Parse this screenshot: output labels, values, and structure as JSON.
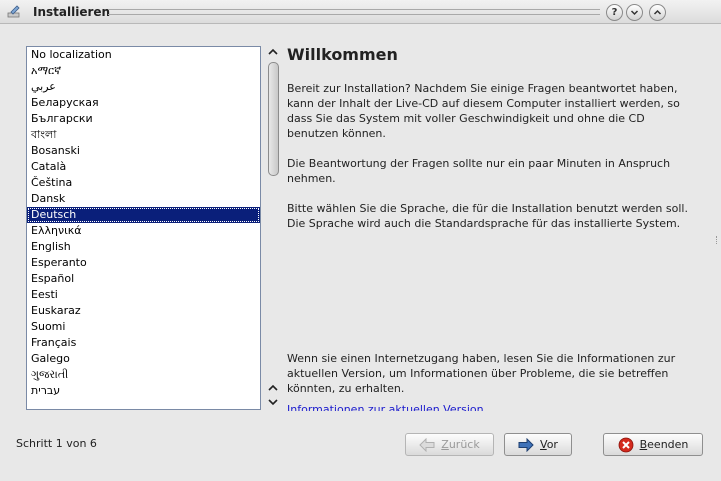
{
  "window": {
    "title": "Installieren",
    "buttons": [
      {
        "name": "help-button",
        "glyph": "?"
      },
      {
        "name": "minimize-button",
        "glyph": "⌄"
      },
      {
        "name": "maximize-button",
        "glyph": "⌃"
      }
    ]
  },
  "languages": {
    "items": [
      "No localization",
      "አማርኛ",
      "عربي",
      "Беларуская",
      "Български",
      "বাংলা",
      "Bosanski",
      "Català",
      "Čeština",
      "Dansk",
      "Deutsch",
      "Ελληνικά",
      "English",
      "Esperanto",
      "Español",
      "Eesti",
      "Euskaraz",
      "Suomi",
      "Français",
      "Galego",
      "ગુજરાતી",
      "עברית"
    ],
    "selected": "Deutsch"
  },
  "content": {
    "title": "Willkommen",
    "para1": "Bereit zur Installation? Nachdem Sie einige Fragen beantwortet haben, kann der Inhalt der Live-CD auf diesem Computer installiert werden, so dass Sie das System mit voller Geschwindigkeit und ohne die CD benutzen können.",
    "para2": "Die Beantwortung der Fragen sollte nur ein paar Minuten in Anspruch nehmen.",
    "para3": "Bitte wählen Sie die Sprache, die für die Installation benutzt werden soll. Die Sprache wird auch die Standardsprache für das installierte System.",
    "para4": "Wenn sie einen Internetzugang haben, lesen Sie die Informationen zur aktuellen Version, um Informationen über Probleme, die sie betreffen könnten, zu erhalten.",
    "link": "Informationen zur aktuellen Version"
  },
  "footer": {
    "step": "Schritt 1 von 6",
    "back_first": "Z",
    "back_rest": "urück",
    "next_first": "V",
    "next_rest": "or",
    "quit_first": "B",
    "quit_rest": "eenden"
  },
  "colors": {
    "selection": "#0a1f7a",
    "link": "#1a1acd",
    "quit_icon": "#d42a1e",
    "arrow_icon": "#2f5f9e"
  }
}
